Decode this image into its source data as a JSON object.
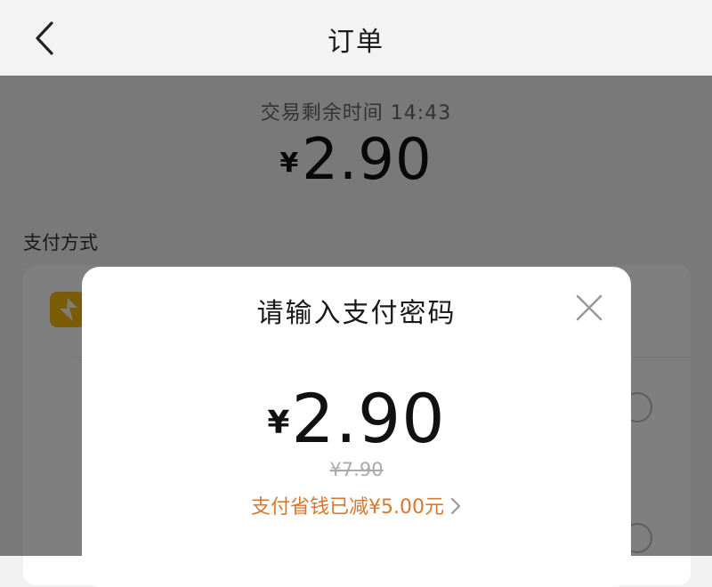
{
  "header": {
    "title": "订单",
    "back_icon": "chevron-left-icon"
  },
  "page": {
    "timer_text": "交易剩余时间 14:43",
    "amount_currency": "¥",
    "amount_value": "2.90",
    "payment_section_label": "支付方式",
    "payment_icon": "lightning-pay-icon"
  },
  "modal": {
    "title": "请输入支付密码",
    "close_icon": "close-icon",
    "amount_currency": "¥",
    "amount_value": "2.90",
    "original_price": "¥7.90",
    "discount_text": "支付省钱已减¥5.00元",
    "discount_chevron_icon": "chevron-right-icon"
  },
  "colors": {
    "accent_orange": "#d9772e",
    "pay_icon_yellow": "#f5b70f",
    "overlay": "rgba(0,0,0,0.5)"
  }
}
